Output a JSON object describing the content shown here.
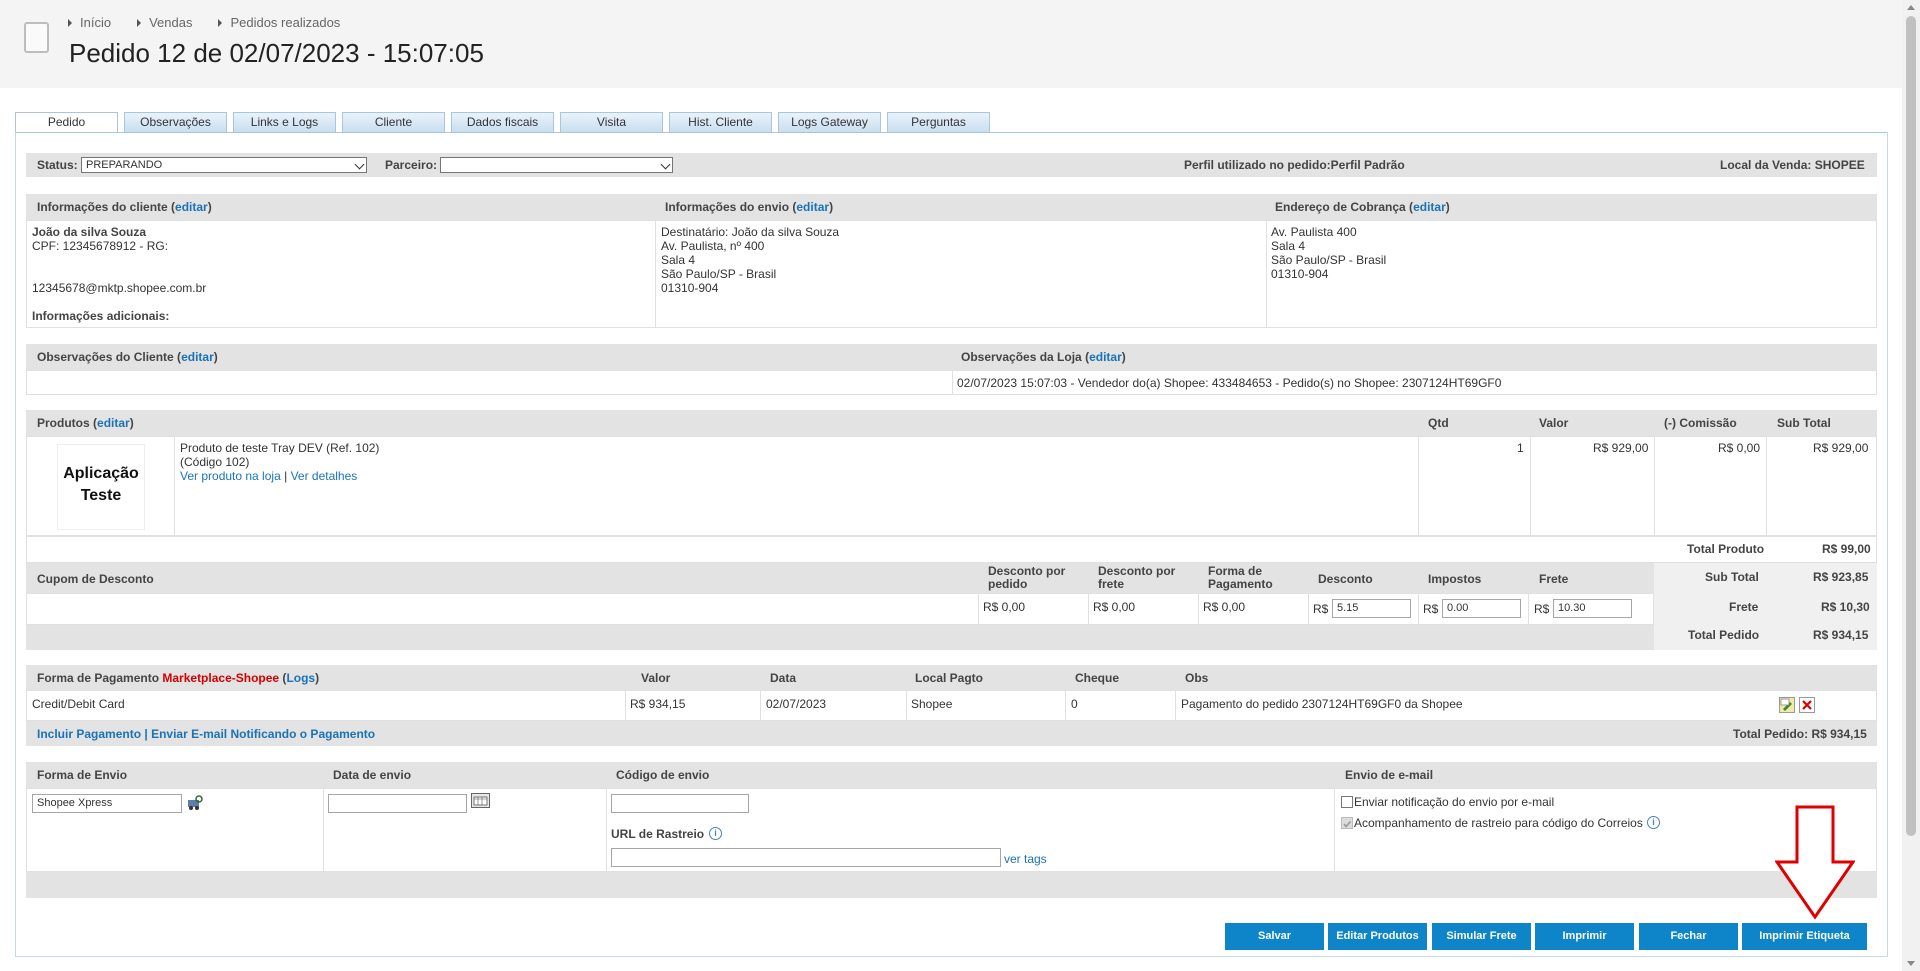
{
  "breadcrumb": [
    "Início",
    "Vendas",
    "Pedidos realizados"
  ],
  "page_title": "Pedido 12 de 02/07/2023 - 15:07:05",
  "tabs": [
    "Pedido",
    "Observações",
    "Links e Logs",
    "Cliente",
    "Dados fiscais",
    "Visita",
    "Hist. Cliente",
    "Logs Gateway",
    "Perguntas"
  ],
  "status_bar": {
    "status_label": "Status:",
    "status_value": "PREPARANDO",
    "partner_label": "Parceiro:",
    "partner_value": "",
    "profile_text": "Perfil utilizado no pedido:Perfil Padrão",
    "sale_location_text": "Local da Venda: SHOPEE"
  },
  "customer": {
    "heading": "Informações do cliente",
    "edit_label": "editar",
    "name": "João da silva Souza",
    "doc": "CPF: 12345678912 - RG:",
    "email": "12345678@mktp.shopee.com.br",
    "additional_label": "Informações adicionais:"
  },
  "shipping_info": {
    "heading": "Informações do envio",
    "edit_label": "editar",
    "lines": [
      "Destinatário: João da silva Souza",
      "Av. Paulista, nº 400",
      "Sala 4",
      "São Paulo/SP - Brasil",
      "01310-904"
    ]
  },
  "billing": {
    "heading": "Endereço de Cobrança",
    "edit_label": "editar",
    "lines": [
      "Av. Paulista 400",
      "Sala 4",
      "São Paulo/SP - Brasil",
      "01310-904"
    ]
  },
  "observations": {
    "client_heading": "Observações do Cliente",
    "store_heading": "Observações da Loja",
    "edit_label": "editar",
    "store_text": "02/07/2023 15:07:03 - Vendedor do(a) Shopee: 433484653 - Pedido(s) no Shopee: 2307124HT69GF0"
  },
  "products": {
    "heading": "Produtos",
    "edit_label": "editar",
    "columns": [
      "Qtd",
      "Valor",
      "(-) Comissão",
      "Sub Total"
    ],
    "image_text_1": "Aplicação",
    "image_text_2": "Teste",
    "items": [
      {
        "name": "Produto de teste Tray DEV (Ref. 102)",
        "code": "(Código 102)",
        "view_store_link": "Ver produto na loja",
        "separator": "|",
        "details_link": "Ver detalhes",
        "qty": "1",
        "value": "R$ 929,00",
        "commission": "R$ 0,00",
        "subtotal": "R$ 929,00"
      }
    ],
    "total_product_label": "Total Produto",
    "total_product_value": "R$ 99,00"
  },
  "discount": {
    "coupon_heading": "Cupom de Desconto",
    "col_order_discount_1": "Desconto por",
    "col_order_discount_2": "pedido",
    "col_freight_discount_1": "Desconto por",
    "col_freight_discount_2": "frete",
    "col_payment_1": "Forma de",
    "col_payment_2": "Pagamento",
    "col_discount": "Desconto",
    "col_taxes": "Impostos",
    "col_freight": "Frete",
    "order_discount_value": "R$ 0,00",
    "freight_discount_value": "R$ 0,00",
    "payment_discount_value": "R$ 0,00",
    "currency": "R$",
    "discount_input": "5.15",
    "taxes_input": "0.00",
    "freight_input": "10.30",
    "subtotal_label": "Sub Total",
    "subtotal_value": "R$ 923,85",
    "freight_label": "Frete",
    "freight_value": "R$ 10,30",
    "total_label": "Total Pedido",
    "total_value": "R$ 934,15"
  },
  "payment": {
    "heading": "Forma de Pagamento",
    "method_name": "Marketplace-Shopee",
    "logs_label": "Logs",
    "columns": [
      "Valor",
      "Data",
      "Local Pagto",
      "Cheque",
      "Obs"
    ],
    "row": {
      "type": "Credit/Debit Card",
      "value": "R$ 934,15",
      "date": "02/07/2023",
      "location": "Shopee",
      "cheque": "0",
      "obs": "Pagamento do pedido 2307124HT69GF0 da Shopee"
    },
    "include_link": "Incluir Pagamento",
    "separator": "|",
    "notify_link": "Enviar E-mail Notificando o Pagamento",
    "total_text": "Total Pedido: R$ 934,15"
  },
  "shipping": {
    "method_heading": "Forma de Envio",
    "date_heading": "Data de envio",
    "code_heading": "Código de envio",
    "email_heading": "Envio de e-mail",
    "method_value": "Shopee Xpress",
    "date_value": "",
    "code_value": "",
    "tracking_label": "URL de Rastreio",
    "tracking_value": "",
    "tags_link": "ver tags",
    "notify_label": "Enviar notificação do envio por e-mail",
    "track_label": "Acompanhamento de rastreio para código do Correios"
  },
  "actions": [
    "Salvar",
    "Editar Produtos",
    "Simular Frete",
    "Imprimir",
    "Fechar",
    "Imprimir Etiqueta"
  ],
  "colors": {
    "accent": "#0e84c9",
    "link": "#1a73b8",
    "marketplace": "#d40000",
    "annotation_arrow": "#e00000"
  }
}
